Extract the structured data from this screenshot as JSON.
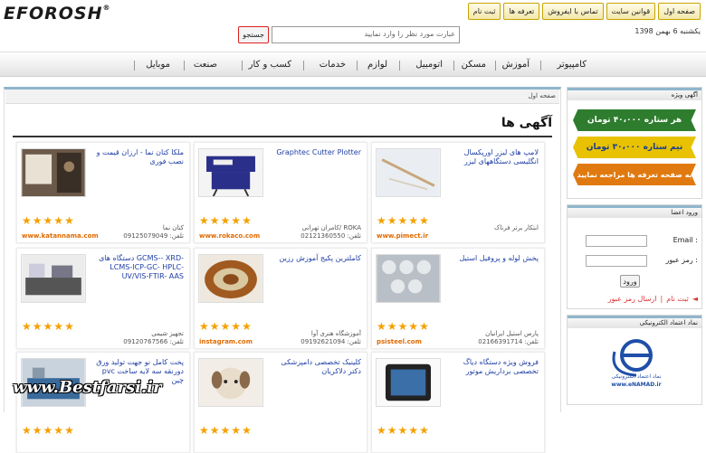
{
  "header": {
    "logo_text": "EFOROSH",
    "logo_mark": "®",
    "date_text": "یکشنبه 6 بهمن 1398",
    "top_links": [
      "صفحه اول",
      "قوانین سایت",
      "تماس با ایفروش",
      "تعرفه ها",
      "ثبت نام"
    ],
    "search_placeholder": "عبارت مورد نظر را وارد نمایید",
    "search_button": "جستجو"
  },
  "nav": [
    "کامپیوتر",
    "آموزش",
    "مسکن",
    "اتومبیل",
    "لوازم",
    "خدمات",
    "کسب و کار",
    "صنعت",
    "موبایل"
  ],
  "main": {
    "breadcrumb": "صفحه اول",
    "section_title": "آگهی ها",
    "cards": [
      {
        "title": "لامپ های لیزر اورپکسال انگلیسی دستگاههای لیزر",
        "meta1": "ابتکار برتر فرناک",
        "meta2": "",
        "url": "www.pimect.ir",
        "img": "laser"
      },
      {
        "title": "Graphtec Cutter Plotter",
        "meta1": "کامران تهرانی/ ROKA",
        "meta2": "تلفن: 02121360550",
        "url": "www.rokaco.com",
        "img": "plotter"
      },
      {
        "title": "ملکا کتان نما - ارزان قیمت و نصب فوری",
        "meta1": "کتان نما",
        "meta2": "تلفن: 09125079049",
        "url": "www.katannama.com",
        "img": "room"
      },
      {
        "title": "پخش لوله و پروفیل استیل",
        "meta1": "پارس استیل ایرانیان",
        "meta2": "تلفن: 02166391714",
        "url": "psisteel.com",
        "img": "pipes"
      },
      {
        "title": "کاملترین پکیج آموزش رزین",
        "meta1": "آموزشگاه هنری آوا",
        "meta2": "تلفن: 09192621094",
        "url": "instagram.com",
        "img": "resin"
      },
      {
        "title": "دستگاه های GCMS-- XRD-LCMS-ICP-GC- HPLC- UV/VIS-FTIR- AAS",
        "meta1": "تجهیز شیمی",
        "meta2": "تلفن: 09120767566",
        "url": "",
        "img": "lab"
      },
      {
        "title": "فروش ویژه دستگاه دیاگ تخصصی برداریش موتور",
        "meta1": "",
        "meta2": "",
        "url": "",
        "img": "tablet"
      },
      {
        "title": "کلینیک تخصصی دامپزشکی دکتر دلاکریان",
        "meta1": "",
        "meta2": "",
        "url": "",
        "img": "puppy"
      },
      {
        "title": "پخت کامل نو جهت تولید ورق pvc دورنقه سه لایه ساخت چین",
        "meta1": "",
        "meta2": "",
        "url": "",
        "img": "factory"
      }
    ]
  },
  "sidebar": {
    "ads_title": "آگهی ویژه",
    "ribbons": [
      "هر ستاره ۴۰،۰۰۰ تومان",
      "نیم ستاره ۳۰،۰۰۰ تومان",
      "به صفحه تعرفه ها مراجعه نمایید"
    ],
    "ribbon_colors": [
      "#2e7d2e",
      "#e8c200",
      "#e07a10"
    ],
    "login_title": "ورود اعضا",
    "email_label": "Email :",
    "password_label": "رمز عبور :",
    "login_button": "ورود",
    "register_link": "ثبت نام",
    "forgot_link": "ارسال رمز عبور",
    "trust_title": "نماد اعتماد الکترونیکی",
    "trust_caption": "نماد اعتماد الکترونیکی",
    "trust_url": "www.eNAMAD.ir"
  },
  "watermark": "www.Bestfarsi.ir"
}
